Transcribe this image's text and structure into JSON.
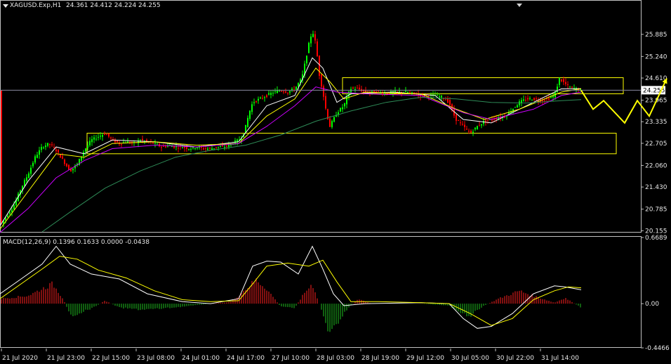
{
  "header": {
    "symbol": "XAGUSD.Exp,H1",
    "ohlc": "24.361 24.412 24.224 24.255",
    "macd_label": "MACD(12,26,9) 0.1396 0.1633 0.0000 -0.0438"
  },
  "colors": {
    "background": "#000000",
    "bull_candle": "#00ff00",
    "bear_candle": "#ff0000",
    "ma_fast": "#ffffff",
    "ma_mid": "#ffff00",
    "ma_slow": "#cc00ff",
    "ma_long": "#2e8b57",
    "zone": "#ffff00",
    "forecast": "#ffff00",
    "macd_hist_pos": "#ff2020",
    "macd_hist_neg": "#20c020",
    "macd_signal": "#ffff00",
    "macd_main": "#ffffff"
  },
  "chart_data": [
    {
      "type": "candlestick",
      "title": "",
      "symbol": "XAGUSD.Exp",
      "timeframe": "H1",
      "current_price": "24.255",
      "y_ticks": [
        "25.885",
        "25.240",
        "24.610",
        "23.965",
        "23.335",
        "22.705",
        "22.060",
        "21.430",
        "20.785",
        "20.155"
      ],
      "ylim": [
        20.12,
        26.6
      ],
      "x_ticks": [
        "21 Jul 2020",
        "21 Jul 23:00",
        "22 Jul 15:00",
        "23 Jul 08:00",
        "24 Jul 01:00",
        "24 Jul 17:00",
        "27 Jul 10:00",
        "28 Jul 03:00",
        "28 Jul 19:00",
        "29 Jul 12:00",
        "30 Jul 05:00",
        "30 Jul 22:00",
        "31 Jul 14:00"
      ],
      "price_path": [
        [
          0,
          20.3
        ],
        [
          10,
          20.6
        ],
        [
          20,
          20.9
        ],
        [
          30,
          21.4
        ],
        [
          40,
          21.8
        ],
        [
          50,
          22.3
        ],
        [
          60,
          22.6
        ],
        [
          70,
          22.7
        ],
        [
          80,
          22.5
        ],
        [
          90,
          22.2
        ],
        [
          100,
          21.9
        ],
        [
          110,
          22.1
        ],
        [
          120,
          22.5
        ],
        [
          130,
          22.8
        ],
        [
          140,
          22.9
        ],
        [
          150,
          23.0
        ],
        [
          160,
          22.8
        ],
        [
          170,
          22.7
        ],
        [
          180,
          22.75
        ],
        [
          190,
          22.7
        ],
        [
          200,
          22.8
        ],
        [
          210,
          22.75
        ],
        [
          220,
          22.7
        ],
        [
          230,
          22.6
        ],
        [
          240,
          22.65
        ],
        [
          250,
          22.6
        ],
        [
          260,
          22.6
        ],
        [
          270,
          22.55
        ],
        [
          280,
          22.6
        ],
        [
          290,
          22.55
        ],
        [
          300,
          22.55
        ],
        [
          310,
          22.6
        ],
        [
          320,
          22.6
        ],
        [
          330,
          22.7
        ],
        [
          340,
          22.8
        ],
        [
          345,
          22.9
        ],
        [
          350,
          23.2
        ],
        [
          355,
          23.6
        ],
        [
          360,
          23.9
        ],
        [
          370,
          24.0
        ],
        [
          380,
          24.1
        ],
        [
          390,
          24.2
        ],
        [
          400,
          24.25
        ],
        [
          410,
          24.2
        ],
        [
          420,
          24.3
        ],
        [
          430,
          24.6
        ],
        [
          435,
          25.1
        ],
        [
          440,
          25.6
        ],
        [
          445,
          26.0
        ],
        [
          450,
          25.6
        ],
        [
          455,
          24.7
        ],
        [
          460,
          24.2
        ],
        [
          465,
          23.6
        ],
        [
          470,
          23.2
        ],
        [
          475,
          23.4
        ],
        [
          480,
          23.6
        ],
        [
          485,
          23.7
        ],
        [
          490,
          23.8
        ],
        [
          495,
          24.1
        ],
        [
          500,
          24.3
        ],
        [
          510,
          24.3
        ],
        [
          520,
          24.2
        ],
        [
          530,
          24.2
        ],
        [
          540,
          24.2
        ],
        [
          550,
          24.15
        ],
        [
          560,
          24.2
        ],
        [
          570,
          24.2
        ],
        [
          580,
          24.2
        ],
        [
          590,
          24.15
        ],
        [
          600,
          24.1
        ],
        [
          610,
          24.1
        ],
        [
          620,
          24.1
        ],
        [
          630,
          24.05
        ],
        [
          640,
          23.9
        ],
        [
          645,
          23.6
        ],
        [
          650,
          23.4
        ],
        [
          660,
          23.2
        ],
        [
          670,
          23.0
        ],
        [
          680,
          23.2
        ],
        [
          690,
          23.35
        ],
        [
          700,
          23.4
        ],
        [
          710,
          23.45
        ],
        [
          720,
          23.5
        ],
        [
          730,
          23.7
        ],
        [
          740,
          23.9
        ],
        [
          750,
          24.0
        ],
        [
          760,
          24.0
        ],
        [
          770,
          23.95
        ],
        [
          780,
          24.0
        ],
        [
          790,
          24.1
        ],
        [
          797,
          24.6
        ],
        [
          802,
          24.5
        ],
        [
          810,
          24.35
        ],
        [
          820,
          24.3
        ],
        [
          828,
          24.25
        ]
      ],
      "moving_averages": [
        {
          "color": "ma_fast",
          "points": [
            [
              0,
              20.3
            ],
            [
              40,
              21.6
            ],
            [
              80,
              22.6
            ],
            [
              120,
              22.4
            ],
            [
              160,
              22.8
            ],
            [
              220,
              22.75
            ],
            [
              280,
              22.6
            ],
            [
              340,
              22.75
            ],
            [
              380,
              23.8
            ],
            [
              420,
              24.1
            ],
            [
              445,
              25.2
            ],
            [
              460,
              24.9
            ],
            [
              480,
              23.9
            ],
            [
              500,
              24.15
            ],
            [
              560,
              24.2
            ],
            [
              620,
              24.1
            ],
            [
              660,
              23.4
            ],
            [
              700,
              23.3
            ],
            [
              760,
              23.9
            ],
            [
              800,
              24.3
            ],
            [
              828,
              24.3
            ]
          ]
        },
        {
          "color": "ma_mid",
          "points": [
            [
              0,
              20.2
            ],
            [
              40,
              21.3
            ],
            [
              80,
              22.4
            ],
            [
              120,
              22.3
            ],
            [
              160,
              22.7
            ],
            [
              220,
              22.75
            ],
            [
              280,
              22.65
            ],
            [
              340,
              22.7
            ],
            [
              380,
              23.5
            ],
            [
              420,
              24.0
            ],
            [
              450,
              24.9
            ],
            [
              470,
              24.5
            ],
            [
              490,
              24.0
            ],
            [
              520,
              24.2
            ],
            [
              600,
              24.15
            ],
            [
              650,
              23.7
            ],
            [
              690,
              23.4
            ],
            [
              740,
              23.7
            ],
            [
              800,
              24.2
            ],
            [
              828,
              24.3
            ]
          ]
        },
        {
          "color": "ma_slow",
          "points": [
            [
              0,
              20.1
            ],
            [
              40,
              20.8
            ],
            [
              80,
              21.7
            ],
            [
              120,
              22.2
            ],
            [
              160,
              22.55
            ],
            [
              220,
              22.65
            ],
            [
              280,
              22.6
            ],
            [
              340,
              22.7
            ],
            [
              380,
              23.2
            ],
            [
              420,
              23.8
            ],
            [
              450,
              24.35
            ],
            [
              480,
              24.2
            ],
            [
              520,
              24.15
            ],
            [
              600,
              24.1
            ],
            [
              660,
              23.6
            ],
            [
              700,
              23.4
            ],
            [
              760,
              23.7
            ],
            [
              800,
              24.1
            ],
            [
              828,
              24.2
            ]
          ]
        },
        {
          "color": "ma_long",
          "points": [
            [
              60,
              20.12
            ],
            [
              100,
              20.7
            ],
            [
              150,
              21.4
            ],
            [
              200,
              21.9
            ],
            [
              250,
              22.3
            ],
            [
              300,
              22.5
            ],
            [
              350,
              22.65
            ],
            [
              400,
              22.95
            ],
            [
              450,
              23.35
            ],
            [
              500,
              23.65
            ],
            [
              550,
              23.9
            ],
            [
              600,
              24.05
            ],
            [
              650,
              24.0
            ],
            [
              700,
              23.9
            ],
            [
              750,
              23.88
            ],
            [
              800,
              23.95
            ],
            [
              828,
              23.98
            ]
          ]
        }
      ],
      "zones": [
        {
          "from_x": 124,
          "to_x": 878,
          "y_top": 23.0,
          "y_bottom": 22.4
        },
        {
          "from_x": 488,
          "to_x": 888,
          "y_top": 24.62,
          "y_bottom": 24.15
        }
      ],
      "forecast_path": [
        [
          828,
          24.25
        ],
        [
          845,
          23.7
        ],
        [
          860,
          23.95
        ],
        [
          890,
          23.3
        ],
        [
          908,
          23.95
        ],
        [
          925,
          23.5
        ],
        [
          950,
          24.6
        ]
      ]
    },
    {
      "type": "bar",
      "title": "MACD(12,26,9)",
      "y_ticks": [
        "0.6689",
        "0.00",
        "-0.4466"
      ],
      "ylim": [
        -0.4466,
        0.6689
      ],
      "histogram_path": [
        [
          0,
          0.05
        ],
        [
          40,
          0.08
        ],
        [
          60,
          0.15
        ],
        [
          75,
          0.2
        ],
        [
          90,
          0.05
        ],
        [
          100,
          -0.12
        ],
        [
          110,
          -0.1
        ],
        [
          130,
          -0.05
        ],
        [
          150,
          0.03
        ],
        [
          170,
          -0.04
        ],
        [
          200,
          -0.06
        ],
        [
          230,
          -0.05
        ],
        [
          260,
          -0.03
        ],
        [
          300,
          0.0
        ],
        [
          330,
          0.02
        ],
        [
          350,
          0.15
        ],
        [
          365,
          0.24
        ],
        [
          380,
          0.15
        ],
        [
          400,
          -0.03
        ],
        [
          420,
          -0.04
        ],
        [
          435,
          0.12
        ],
        [
          445,
          0.2
        ],
        [
          455,
          0.0
        ],
        [
          470,
          -0.32
        ],
        [
          480,
          -0.2
        ],
        [
          495,
          -0.05
        ],
        [
          510,
          0.05
        ],
        [
          530,
          0.0
        ],
        [
          600,
          0.0
        ],
        [
          640,
          -0.02
        ],
        [
          655,
          -0.1
        ],
        [
          670,
          -0.12
        ],
        [
          690,
          -0.02
        ],
        [
          710,
          0.05
        ],
        [
          740,
          0.13
        ],
        [
          760,
          0.08
        ],
        [
          790,
          0.01
        ],
        [
          805,
          0.06
        ],
        [
          828,
          -0.04
        ]
      ],
      "macd_path": [
        [
          0,
          0.1
        ],
        [
          30,
          0.25
        ],
        [
          60,
          0.4
        ],
        [
          80,
          0.58
        ],
        [
          100,
          0.4
        ],
        [
          130,
          0.3
        ],
        [
          170,
          0.25
        ],
        [
          210,
          0.1
        ],
        [
          260,
          0.02
        ],
        [
          300,
          0.0
        ],
        [
          340,
          0.05
        ],
        [
          360,
          0.38
        ],
        [
          380,
          0.43
        ],
        [
          400,
          0.42
        ],
        [
          425,
          0.3
        ],
        [
          445,
          0.58
        ],
        [
          460,
          0.35
        ],
        [
          475,
          0.1
        ],
        [
          490,
          -0.02
        ],
        [
          520,
          0.0
        ],
        [
          600,
          0.01
        ],
        [
          640,
          0.0
        ],
        [
          660,
          -0.15
        ],
        [
          680,
          -0.25
        ],
        [
          700,
          -0.23
        ],
        [
          730,
          -0.1
        ],
        [
          760,
          0.1
        ],
        [
          790,
          0.18
        ],
        [
          805,
          0.17
        ],
        [
          828,
          0.14
        ]
      ],
      "signal_path": [
        [
          0,
          0.05
        ],
        [
          30,
          0.2
        ],
        [
          60,
          0.35
        ],
        [
          85,
          0.48
        ],
        [
          110,
          0.45
        ],
        [
          140,
          0.34
        ],
        [
          180,
          0.26
        ],
        [
          220,
          0.13
        ],
        [
          260,
          0.04
        ],
        [
          300,
          0.02
        ],
        [
          340,
          0.03
        ],
        [
          360,
          0.2
        ],
        [
          380,
          0.38
        ],
        [
          410,
          0.41
        ],
        [
          440,
          0.38
        ],
        [
          460,
          0.44
        ],
        [
          480,
          0.22
        ],
        [
          500,
          0.02
        ],
        [
          540,
          0.02
        ],
        [
          600,
          0.01
        ],
        [
          640,
          0.0
        ],
        [
          670,
          -0.1
        ],
        [
          700,
          -0.22
        ],
        [
          730,
          -0.15
        ],
        [
          760,
          0.04
        ],
        [
          790,
          0.13
        ],
        [
          810,
          0.17
        ],
        [
          828,
          0.16
        ]
      ]
    }
  ]
}
